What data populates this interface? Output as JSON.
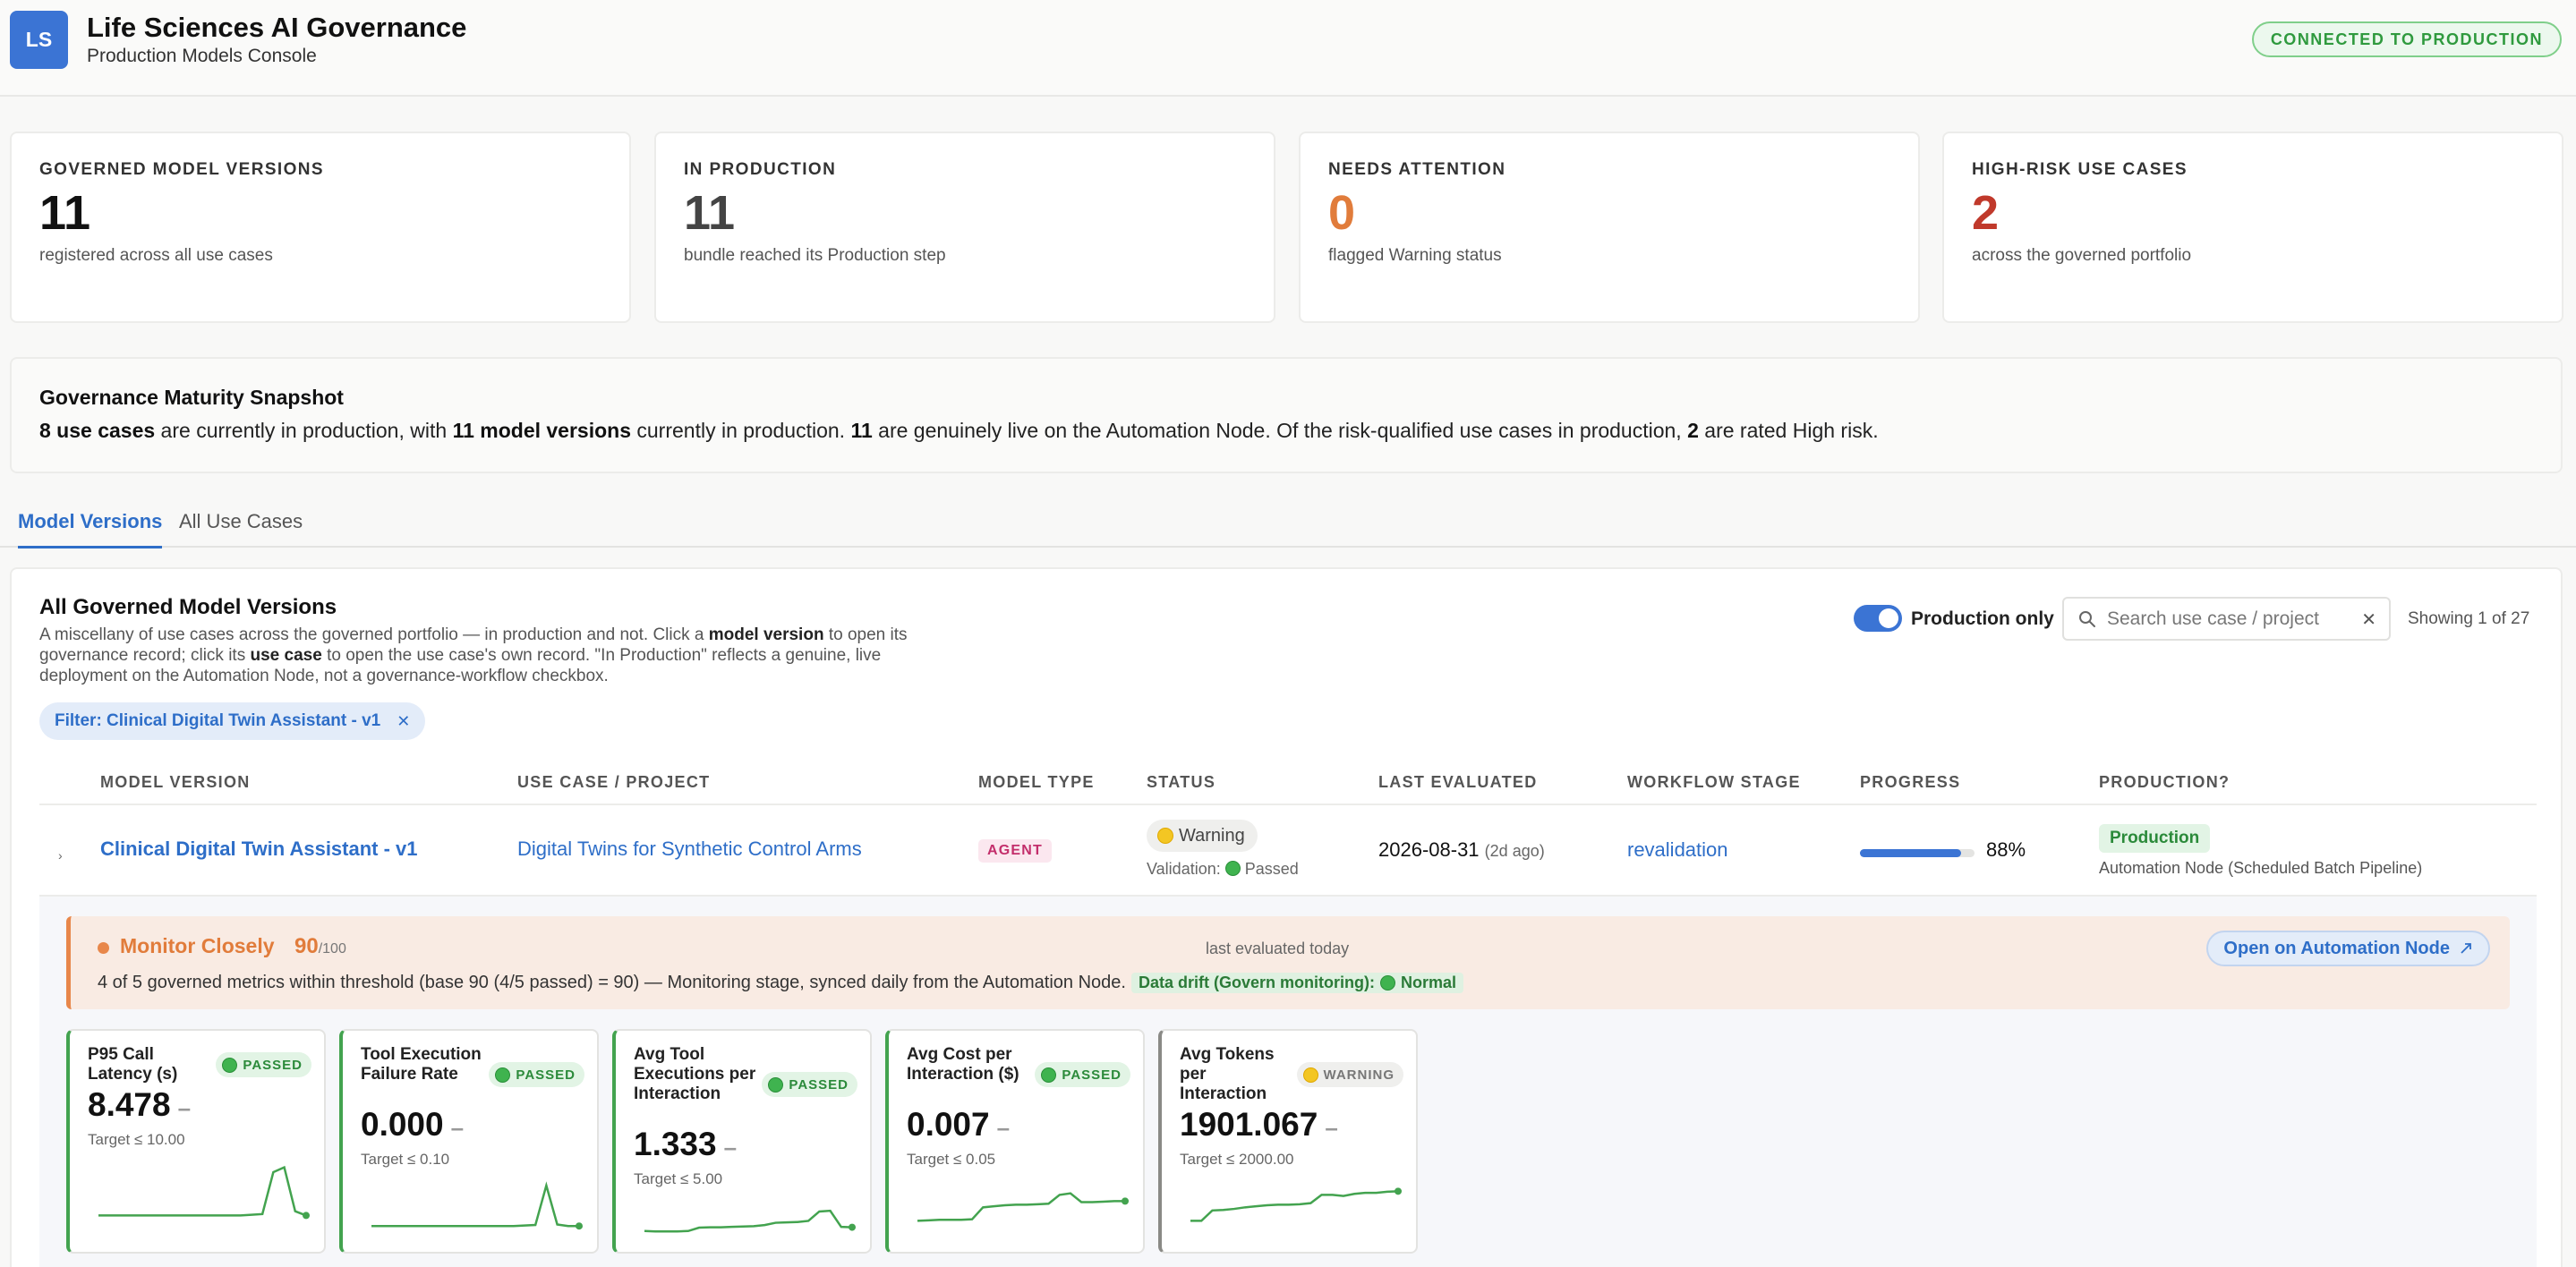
{
  "app": {
    "logo": "LS",
    "title": "Life Sciences AI Governance",
    "subtitle": "Production Models Console",
    "connection_status": "CONNECTED TO PRODUCTION"
  },
  "stats": [
    {
      "label": "GOVERNED MODEL VERSIONS",
      "value": "11",
      "desc": "registered across all use cases",
      "color": "#111111"
    },
    {
      "label": "IN PRODUCTION",
      "value": "11",
      "desc": "bundle reached its Production step",
      "color": "#444444"
    },
    {
      "label": "NEEDS ATTENTION",
      "value": "0",
      "desc": "flagged Warning status",
      "color": "#e17c3b"
    },
    {
      "label": "HIGH-RISK USE CASES",
      "value": "2",
      "desc": "across the governed portfolio",
      "color": "#c0392b"
    }
  ],
  "snapshot": {
    "title": "Governance Maturity Snapshot",
    "use_cases": "8 use cases",
    "t1": " are currently in production, with ",
    "model_versions": "11 model versions",
    "t2": " currently in production. ",
    "live_count": "11",
    "t3": " are genuinely live on the Automation Node. Of the risk-qualified use cases in production, ",
    "high_count": "2",
    "t4": " are rated High risk."
  },
  "tabs": [
    {
      "label": "Model Versions",
      "active": true
    },
    {
      "label": "All Use Cases",
      "active": false
    }
  ],
  "panel": {
    "title": "All Governed Model Versions",
    "desc_1": "A miscellany of use cases across the governed portfolio — in production and not. Click a ",
    "desc_b1": "model version",
    "desc_2": " to open its governance record; click its ",
    "desc_b2": "use case",
    "desc_3": " to open the use case's own record. \"In Production\" reflects a genuine, live deployment on the Automation Node, not a governance-workflow checkbox.",
    "toggle_label": "Production only",
    "toggle_on": true,
    "search_placeholder": "Search use case / project",
    "search_value": "",
    "showing": "Showing 1 of 27",
    "filter_chip": "Filter: Clinical Digital Twin Assistant - v1"
  },
  "table": {
    "headers": [
      "MODEL VERSION",
      "USE CASE / PROJECT",
      "MODEL TYPE",
      "STATUS",
      "LAST EVALUATED",
      "WORKFLOW STAGE",
      "PROGRESS",
      "PRODUCTION?"
    ],
    "row": {
      "chevron": "›",
      "model_version": "Clinical Digital Twin Assistant - v1",
      "use_case": "Digital Twins for Synthetic Control Arms",
      "model_type": "AGENT",
      "status": "Warning",
      "validation_label": "Validation:",
      "validation_value": "Passed",
      "last_evaluated": "2026-08-31",
      "last_evaluated_rel": "(2d ago)",
      "workflow_stage": "revalidation",
      "progress": 0.88,
      "progress_label": "88%",
      "production": "Production",
      "production_node": "Automation Node (Scheduled Batch Pipeline)"
    }
  },
  "monitor": {
    "title": "Monitor Closely",
    "score": "90",
    "score_max": "/100",
    "evaluated": "last evaluated today",
    "open_button": "Open on Automation Node",
    "summary": "4 of 5 governed metrics within threshold (base 90 (4/5 passed) = 90) — Monitoring stage, synced daily from the Automation Node.",
    "drift_label": "Data drift (Govern monitoring):",
    "drift_value": "Normal"
  },
  "metrics": [
    {
      "title": "P95 Call Latency (s)",
      "status": "PASSED",
      "value": "8.478",
      "target": "Target ≤ 10.00",
      "series": [
        2.0,
        2.0,
        2.0,
        2.0,
        2.0,
        2.0,
        2.0,
        2.0,
        2.0,
        2.0,
        2.0,
        2.0,
        2.0,
        2.0,
        2.1,
        2.2,
        8.2,
        8.9,
        2.6,
        2.0
      ]
    },
    {
      "title": "Tool Execution Failure Rate",
      "status": "PASSED",
      "value": "0.000",
      "target": "Target ≤ 0.10",
      "series": [
        1.0,
        1.0,
        1.0,
        1.0,
        1.0,
        1.0,
        1.0,
        1.0,
        1.0,
        1.0,
        1.0,
        1.0,
        1.0,
        1.0,
        1.1,
        1.2,
        8.8,
        1.3,
        1.0,
        1.0
      ]
    },
    {
      "title": "Avg Tool Executions per Interaction",
      "status": "PASSED",
      "value": "1.333",
      "target": "Target ≤ 5.00",
      "series": [
        1.0,
        0.9,
        0.9,
        0.9,
        1.0,
        1.9,
        2.0,
        2.0,
        2.1,
        2.2,
        2.3,
        2.6,
        3.2,
        3.3,
        3.4,
        3.7,
        6.2,
        6.4,
        2.1,
        2.0
      ]
    },
    {
      "title": "Avg Cost per Interaction ($)",
      "status": "PASSED",
      "value": "0.007",
      "target": "Target ≤ 0.05",
      "series": [
        2.0,
        2.1,
        2.2,
        2.2,
        2.2,
        2.3,
        4.6,
        4.8,
        5.0,
        5.1,
        5.1,
        5.2,
        5.3,
        7.0,
        7.3,
        5.6,
        5.6,
        5.7,
        5.8,
        5.8
      ]
    },
    {
      "title": "Avg Tokens per Interaction",
      "status": "WARNING",
      "value": "1901.067",
      "target": "Target ≤ 2000.00",
      "series": [
        2.0,
        2.0,
        4.0,
        4.1,
        4.3,
        4.6,
        4.8,
        5.0,
        5.1,
        5.1,
        5.2,
        5.4,
        7.0,
        7.0,
        6.8,
        7.2,
        7.4,
        7.4,
        7.6,
        7.7
      ]
    }
  ],
  "colors": {
    "accent": "#3b74d4",
    "link": "#2e6ec8",
    "passed": "#43a34f",
    "warning": "#e17c3b",
    "danger": "#c0392b"
  },
  "icons": {
    "search": "search-icon",
    "close": "close-icon",
    "external": "external-link-icon",
    "chevron": "chevron-right-icon"
  }
}
